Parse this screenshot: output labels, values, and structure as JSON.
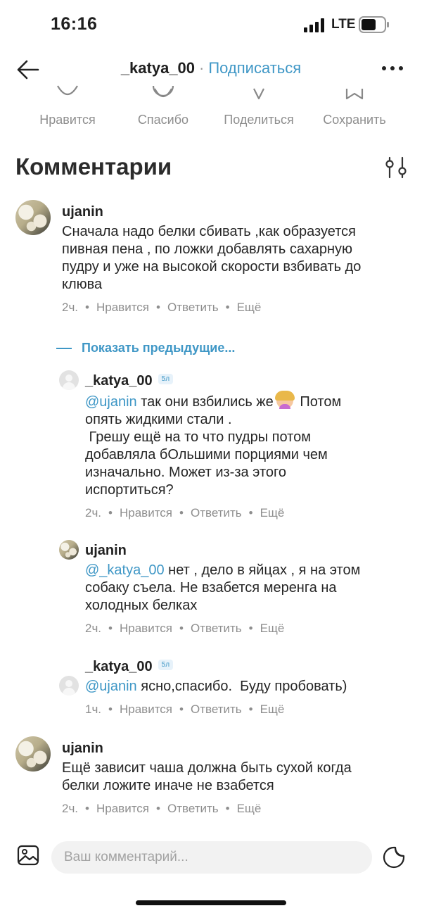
{
  "status": {
    "time": "16:16",
    "network": "LTE"
  },
  "header": {
    "username": "_katya_00",
    "separator": "·",
    "subscribe_label": "Подписаться"
  },
  "actions": [
    {
      "label": "Нравится",
      "icon": "heart-icon"
    },
    {
      "label": "Спасибо",
      "icon": "smile-icon"
    },
    {
      "label": "Поделиться",
      "icon": "share-icon"
    },
    {
      "label": "Сохранить",
      "icon": "bookmark-icon"
    }
  ],
  "comments_title": "Комментарии",
  "show_previous": "Показать предыдущие...",
  "meta_labels": {
    "like": "Нравится",
    "reply": "Ответить",
    "more": "Ещё"
  },
  "comments": [
    {
      "user": "ujanin",
      "lines": [
        "Сначала надо белки сбивать ,как образуется",
        "пивная пена , по ложки добавлять сахарную",
        "пудру и уже на высокой скорости взбивать до",
        "клюва"
      ],
      "time": "2ч."
    },
    {
      "user": "_katya_00",
      "badge": "5л",
      "mention": "@ujanin",
      "first_line": " так они взбились же",
      "first_line_end": " Потом",
      "lines": [
        "опять жидкими стали .",
        " Грешу ещё на то что пудры потом",
        "добавляла бОльшими порциями чем",
        "изначально. Может из-за этого",
        "испортиться?"
      ],
      "time": "2ч."
    },
    {
      "user": "ujanin",
      "mention": "@_katya_00",
      "first_line": " нет , дело в яйцах , я на этом",
      "lines": [
        "собаку съела. Не взабется меренга на",
        "холодных белках"
      ],
      "time": "2ч."
    },
    {
      "user": "_katya_00",
      "badge": "5л",
      "mention": "@ujanin",
      "first_line": " ясно,спасибо.  Буду пробовать)",
      "time": "1ч."
    },
    {
      "user": "ujanin",
      "lines": [
        "Ещё зависит чаша должна быть сухой когда",
        "белки ложите иначе не взабется"
      ],
      "time": "2ч."
    }
  ],
  "composer": {
    "placeholder": "Ваш комментарий..."
  }
}
